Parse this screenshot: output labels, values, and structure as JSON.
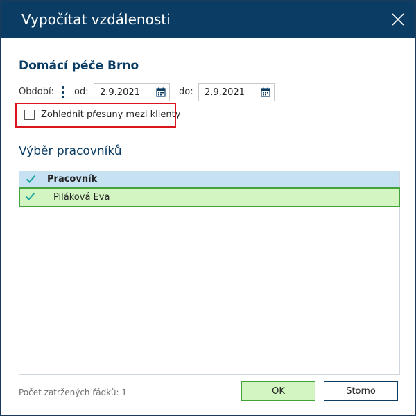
{
  "window": {
    "title": "Vypočítat vzdálenosti"
  },
  "header": {
    "organization": "Domácí péče Brno"
  },
  "period": {
    "label": "Období:",
    "from_label": "od:",
    "from_value": "2.9.2021",
    "to_label": "do:",
    "to_value": "2.9.2021"
  },
  "options": {
    "consider_transfers_label": "Zohlednit přesuny mezi klienty",
    "consider_transfers_checked": false
  },
  "workers": {
    "section_title": "Výběr pracovníků",
    "column_header": "Pracovník",
    "rows": [
      {
        "name": "Piláková Eva",
        "checked": true
      }
    ]
  },
  "footer": {
    "status": "Počet zatržených řádků: 1",
    "ok_label": "OK",
    "cancel_label": "Storno"
  },
  "colors": {
    "titlebar": "#0b3c63",
    "accent_text": "#0b3c63",
    "highlight": "#d9161c",
    "selected_row_bg": "#d2f5c2",
    "selected_row_border": "#43a23a",
    "header_bg": "#c6e2f2",
    "checkmark": "#1aa39a"
  },
  "icons": {
    "close": "close-icon",
    "menu": "kebab-menu-icon",
    "calendar": "calendar-icon",
    "check": "checkmark-icon"
  }
}
